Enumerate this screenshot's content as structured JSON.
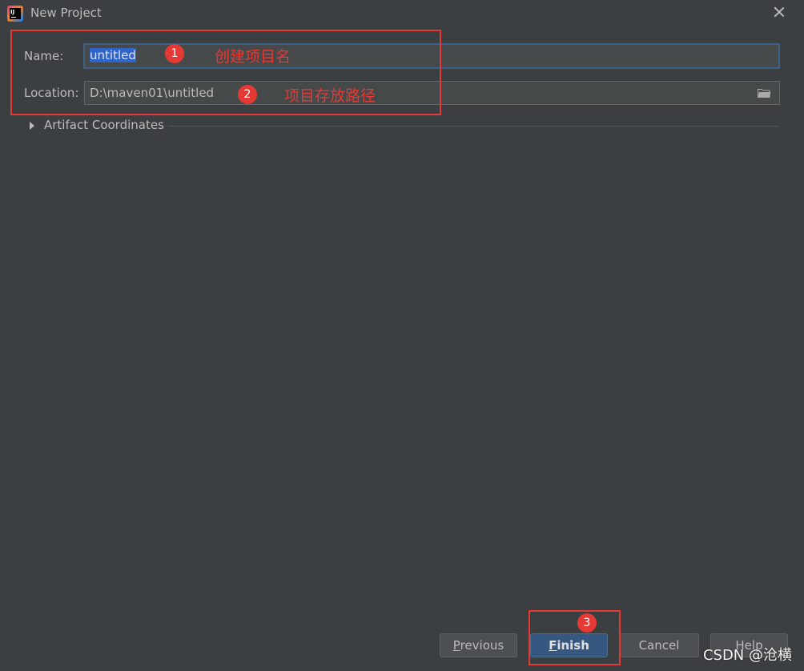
{
  "window": {
    "title": "New Project",
    "app_icon_text": "IJ"
  },
  "form": {
    "name_label": "Name:",
    "name_value": "untitled",
    "location_label": "Location:",
    "location_value": "D:\\maven01\\untitled",
    "artifact_coordinates_label": "Artifact Coordinates"
  },
  "annotations": {
    "badge1": "1",
    "text1": "创建项目名",
    "badge2": "2",
    "text2": "项目存放路径",
    "badge3": "3",
    "color": "#e53935"
  },
  "buttons": {
    "previous_mnemonic": "P",
    "previous_rest": "revious",
    "finish_mnemonic": "F",
    "finish_rest": "inish",
    "cancel": "Cancel",
    "help": "Help"
  },
  "watermark": "CSDN @沧横",
  "colors": {
    "background": "#3c3f41",
    "field_background": "#45494a",
    "focus_border": "#3d6185",
    "selection": "#2f65ca",
    "primary_button": "#365880"
  },
  "icons": {
    "app": "intellij-idea-icon",
    "close": "close-icon",
    "folder": "folder-icon",
    "expand": "triangle-right-icon"
  }
}
